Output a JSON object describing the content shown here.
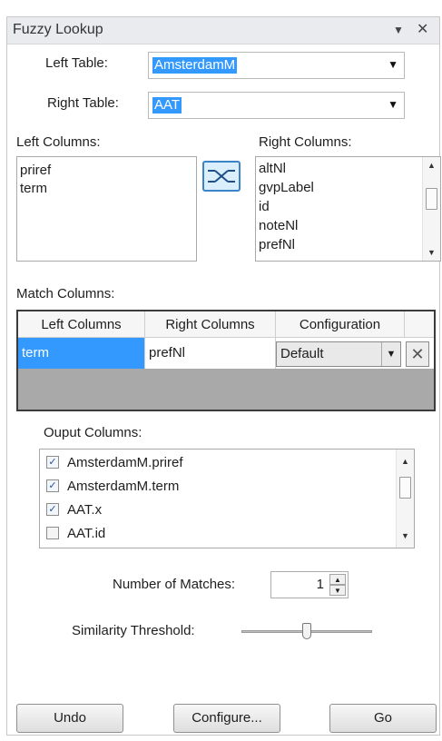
{
  "panel": {
    "title": "Fuzzy Lookup",
    "dropdown_glyph": "▼",
    "close_glyph": "✕"
  },
  "left_table": {
    "label": "Left Table:",
    "value": "AmsterdamM"
  },
  "right_table": {
    "label": "Right Table:",
    "value": "AAT"
  },
  "left_columns": {
    "label": "Left Columns:",
    "items": [
      "priref",
      "term"
    ]
  },
  "right_columns": {
    "label": "Right Columns:",
    "items": [
      "altNl",
      "gvpLabel",
      "id",
      "noteNl",
      "prefNl"
    ]
  },
  "match_columns": {
    "label": "Match Columns:",
    "headers": [
      "Left Columns",
      "Right Columns",
      "Configuration"
    ],
    "rows": [
      {
        "left": "term",
        "right": "prefNl",
        "configuration": "Default"
      }
    ],
    "delete_glyph": "✕"
  },
  "output_columns": {
    "label": "Ouput Columns:",
    "items": [
      {
        "label": "AmsterdamM.priref",
        "checked": true
      },
      {
        "label": "AmsterdamM.term",
        "checked": true
      },
      {
        "label": "AAT.x",
        "checked": true
      },
      {
        "label": "AAT.id",
        "checked": false
      }
    ]
  },
  "number_of_matches": {
    "label": "Number of Matches:",
    "value": "1"
  },
  "similarity_threshold": {
    "label": "Similarity Threshold:",
    "value_fraction": 0.5
  },
  "buttons": {
    "undo": "Undo",
    "configure": "Configure...",
    "go": "Go"
  },
  "colors": {
    "selection": "#3399ff",
    "accent_border": "#3a83c8"
  },
  "icons": {
    "map_button": "column-mapping-icon",
    "check": "✓"
  }
}
